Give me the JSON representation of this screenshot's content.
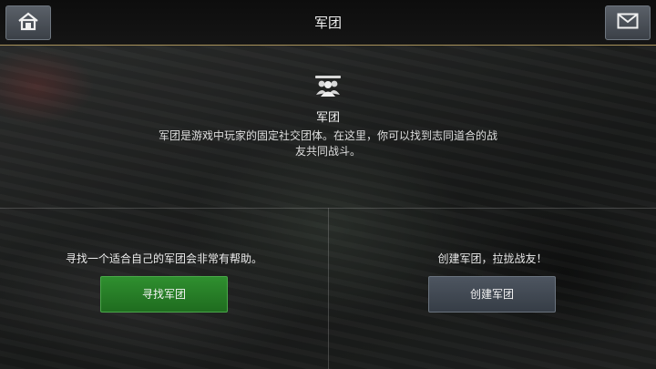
{
  "header": {
    "title": "军团",
    "home_icon": "home-icon",
    "mail_icon": "mail-icon"
  },
  "info": {
    "icon": "legion-group-icon",
    "title": "军团",
    "description": "军团是游戏中玩家的固定社交团体。在这里，你可以找到志同道合的战友共同战斗。"
  },
  "find_panel": {
    "text": "寻找一个适合自己的军团会非常有帮助。",
    "button_label": "寻找军团",
    "button_color": "#2a7f2a"
  },
  "create_panel": {
    "text": "创建军团，拉拢战友！",
    "button_label": "创建军团",
    "button_color": "#434a54"
  }
}
